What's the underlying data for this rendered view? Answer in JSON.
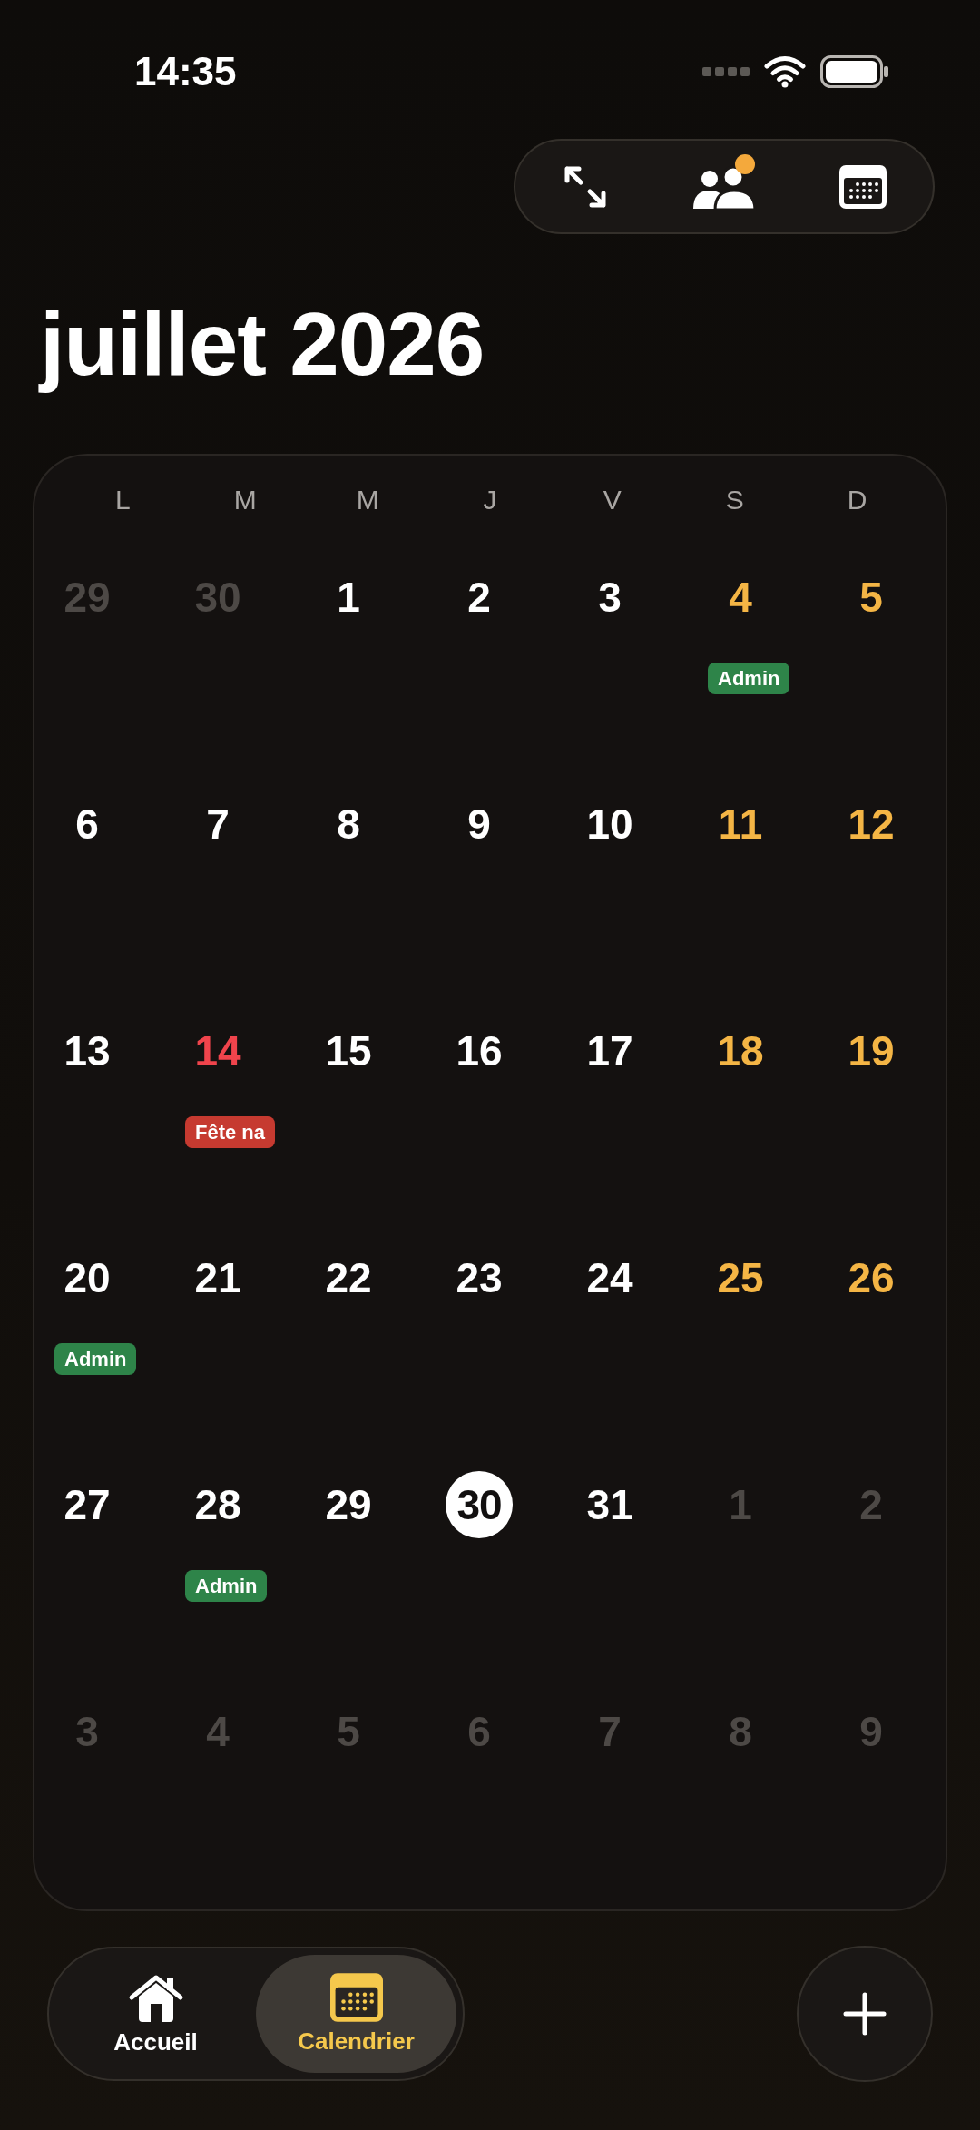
{
  "status_bar": {
    "time": "14:35"
  },
  "toolbar": {
    "people_badge": true
  },
  "month_title": "juillet 2026",
  "calendar": {
    "weekdays": [
      "L",
      "M",
      "M",
      "J",
      "V",
      "S",
      "D"
    ],
    "days": [
      {
        "day": "29",
        "kind": "outside",
        "today": false
      },
      {
        "day": "30",
        "kind": "outside",
        "today": false
      },
      {
        "day": "1",
        "kind": "weekday",
        "today": false
      },
      {
        "day": "2",
        "kind": "weekday",
        "today": false
      },
      {
        "day": "3",
        "kind": "weekday",
        "today": false
      },
      {
        "day": "4",
        "kind": "weekend",
        "today": false,
        "events": [
          {
            "title": "Admin",
            "color": "#2e8449"
          }
        ]
      },
      {
        "day": "5",
        "kind": "weekend",
        "today": false
      },
      {
        "day": "6",
        "kind": "weekday",
        "today": false
      },
      {
        "day": "7",
        "kind": "weekday",
        "today": false
      },
      {
        "day": "8",
        "kind": "weekday",
        "today": false
      },
      {
        "day": "9",
        "kind": "weekday",
        "today": false
      },
      {
        "day": "10",
        "kind": "weekday",
        "today": false
      },
      {
        "day": "11",
        "kind": "weekend",
        "today": false
      },
      {
        "day": "12",
        "kind": "weekend",
        "today": false
      },
      {
        "day": "13",
        "kind": "weekday",
        "today": false
      },
      {
        "day": "14",
        "kind": "holiday",
        "today": false,
        "events": [
          {
            "title": "Fête na",
            "color": "#c63a30"
          }
        ]
      },
      {
        "day": "15",
        "kind": "weekday",
        "today": false
      },
      {
        "day": "16",
        "kind": "weekday",
        "today": false
      },
      {
        "day": "17",
        "kind": "weekday",
        "today": false
      },
      {
        "day": "18",
        "kind": "weekend",
        "today": false
      },
      {
        "day": "19",
        "kind": "weekend",
        "today": false
      },
      {
        "day": "20",
        "kind": "weekday",
        "today": false,
        "events": [
          {
            "title": "Admin",
            "color": "#2e8449"
          }
        ]
      },
      {
        "day": "21",
        "kind": "weekday",
        "today": false
      },
      {
        "day": "22",
        "kind": "weekday",
        "today": false
      },
      {
        "day": "23",
        "kind": "weekday",
        "today": false
      },
      {
        "day": "24",
        "kind": "weekday",
        "today": false
      },
      {
        "day": "25",
        "kind": "weekend",
        "today": false
      },
      {
        "day": "26",
        "kind": "weekend",
        "today": false
      },
      {
        "day": "27",
        "kind": "weekday",
        "today": false
      },
      {
        "day": "28",
        "kind": "weekday",
        "today": false,
        "events": [
          {
            "title": "Admin",
            "color": "#2e8449"
          }
        ]
      },
      {
        "day": "29",
        "kind": "weekday",
        "today": false
      },
      {
        "day": "30",
        "kind": "weekday",
        "today": true
      },
      {
        "day": "31",
        "kind": "weekday",
        "today": false
      },
      {
        "day": "1",
        "kind": "outside",
        "today": false
      },
      {
        "day": "2",
        "kind": "outside",
        "today": false
      },
      {
        "day": "3",
        "kind": "outside",
        "today": false
      },
      {
        "day": "4",
        "kind": "outside",
        "today": false
      },
      {
        "day": "5",
        "kind": "outside",
        "today": false
      },
      {
        "day": "6",
        "kind": "outside",
        "today": false
      },
      {
        "day": "7",
        "kind": "outside",
        "today": false
      },
      {
        "day": "8",
        "kind": "outside",
        "today": false
      },
      {
        "day": "9",
        "kind": "outside",
        "today": false
      }
    ]
  },
  "tab_bar": {
    "tabs": [
      {
        "label": "Accueil",
        "selected": false
      },
      {
        "label": "Calendrier",
        "selected": true
      }
    ]
  }
}
